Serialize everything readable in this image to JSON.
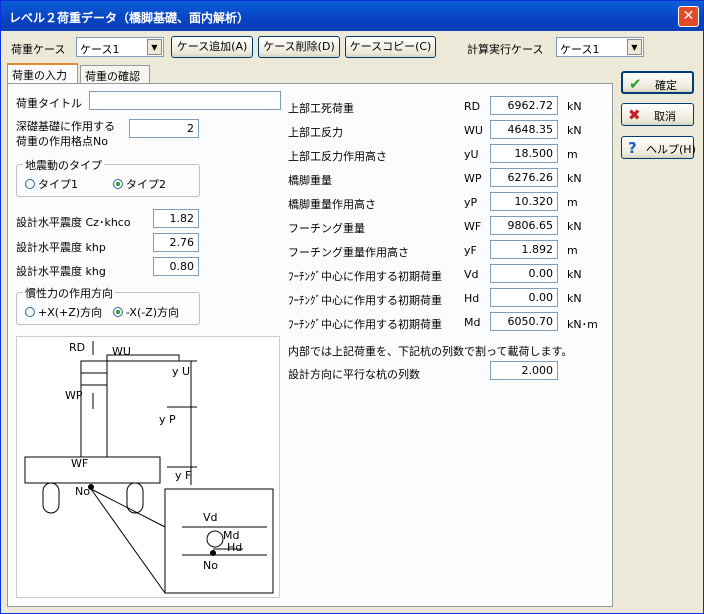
{
  "window": {
    "title": "レベル２荷重データ（橋脚基礎、面内解析）",
    "close": "✕"
  },
  "toolbar": {
    "case_label": "荷重ケース",
    "case_value": "ケース1",
    "add": "ケース追加(A)",
    "del": "ケース削除(D)",
    "copy": "ケースコピー(C)",
    "calc_label": "計算実行ケース",
    "calc_value": "ケース1"
  },
  "tabs": [
    "荷重の入力",
    "荷重の確認"
  ],
  "side": {
    "ok": "確定",
    "cancel": "取消",
    "help": "ヘルプ(H)"
  },
  "left": {
    "title_label": "荷重タイトル",
    "title_value": "",
    "point_label1": "深礎基礎に作用する",
    "point_label2": "荷重の作用格点No",
    "point_value": "2",
    "quake_group": "地震動のタイプ",
    "type1": "タイプ1",
    "type2": "タイプ2",
    "k1_label": "設計水平震度  Cz･khco",
    "k1": "1.82",
    "k2_label": "設計水平震度  khp",
    "k2": "2.76",
    "k3_label": "設計水平震度  khg",
    "k3": "0.80",
    "dir_group": "慣性力の作用方向",
    "dir1": "+X(+Z)方向",
    "dir2": "-X(-Z)方向"
  },
  "rows": [
    {
      "label": "上部工死荷重",
      "sym": "RD",
      "value": "6962.72",
      "unit": "kN"
    },
    {
      "label": "上部工反力",
      "sym": "WU",
      "value": "4648.35",
      "unit": "kN"
    },
    {
      "label": "上部工反力作用高さ",
      "sym": "yU",
      "value": "18.500",
      "unit": "m"
    },
    {
      "label": "橋脚重量",
      "sym": "WP",
      "value": "6276.26",
      "unit": "kN"
    },
    {
      "label": "橋脚重量作用高さ",
      "sym": "yP",
      "value": "10.320",
      "unit": "m"
    },
    {
      "label": "フーチング重量",
      "sym": "WF",
      "value": "9806.65",
      "unit": "kN"
    },
    {
      "label": "フーチング重量作用高さ",
      "sym": "yF",
      "value": "1.892",
      "unit": "m"
    },
    {
      "label": "ﾌｰﾁﾝｸﾞ中心に作用する初期荷重",
      "sym": "Vd",
      "value": "0.00",
      "unit": "kN"
    },
    {
      "label": "ﾌｰﾁﾝｸﾞ中心に作用する初期荷重",
      "sym": "Hd",
      "value": "0.00",
      "unit": "kN"
    },
    {
      "label": "ﾌｰﾁﾝｸﾞ中心に作用する初期荷重",
      "sym": "Md",
      "value": "6050.70",
      "unit": "kN･m"
    }
  ],
  "note": "内部では上記荷重を、下記杭の列数で割って載荷します。",
  "piles": {
    "label": "設計方向に平行な杭の列数",
    "value": "2.000"
  },
  "diagram": {
    "rd": "RD",
    "wu": "WU",
    "wp": "WP",
    "yu": "y U",
    "yp": "y P",
    "wf": "WF",
    "yf": "y F",
    "no": "No",
    "vd": "Vd",
    "md": "Md",
    "hd": "Hd",
    "no2": "No"
  }
}
